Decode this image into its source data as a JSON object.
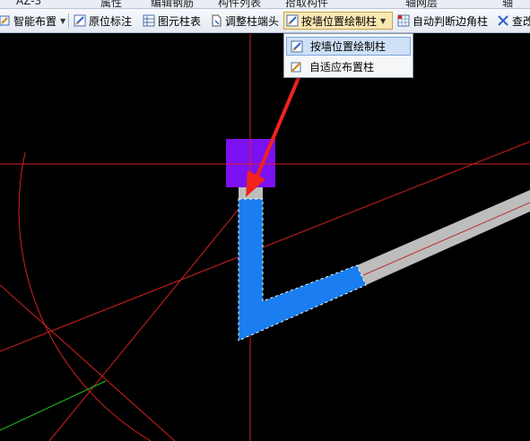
{
  "top_row": {
    "partial_texts": [
      "AZ-3",
      "属性",
      "编辑钢筋",
      "构件列表",
      "拾取构件",
      "轴网层",
      "轴"
    ]
  },
  "toolbar": {
    "items": [
      {
        "label": "智能布置",
        "icon": "smart-layout-icon",
        "has_dropdown": true
      },
      {
        "label": "原位标注",
        "icon": "in-place-label-icon",
        "has_dropdown": false
      },
      {
        "label": "图元柱表",
        "icon": "column-table-icon",
        "has_dropdown": false
      },
      {
        "label": "调整柱端头",
        "icon": "adjust-column-end-icon",
        "has_dropdown": false
      },
      {
        "label": "按墙位置绘制柱",
        "icon": "draw-column-by-wall-icon",
        "has_dropdown": true,
        "active": true
      },
      {
        "label": "自动判断边角柱",
        "icon": "auto-corner-column-icon",
        "has_dropdown": false
      },
      {
        "label": "查改",
        "icon": "find-modify-icon",
        "has_dropdown": false
      }
    ]
  },
  "dropdown": {
    "items": [
      {
        "label": "按墙位置绘制柱",
        "icon": "draw-column-by-wall-icon",
        "highlighted": true
      },
      {
        "label": "自适应布置柱",
        "icon": "adaptive-column-icon",
        "highlighted": false
      }
    ]
  },
  "colors": {
    "canvas_bg": "#000000",
    "axis_line": "#d42020",
    "wall_selected": "#1a7ef0",
    "wall_default": "#bdbdbd",
    "column": "#7b10f0",
    "arrow": "#f2221c",
    "green_axis": "#1fbf1f"
  }
}
